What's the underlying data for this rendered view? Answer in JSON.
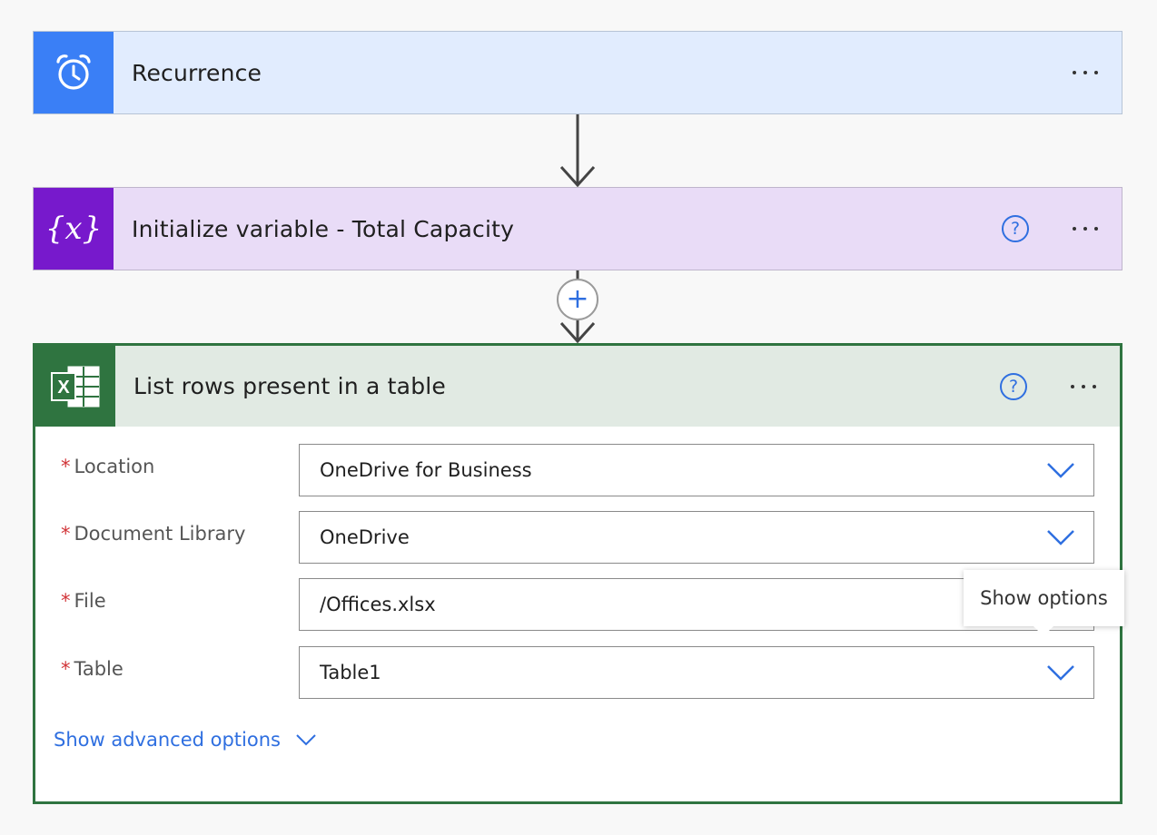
{
  "steps": {
    "recurrence": {
      "title": "Recurrence",
      "icon": "alarm-clock-icon",
      "color": "#3a7ff6",
      "bg": "#e1ecfe"
    },
    "init_var": {
      "title": "Initialize variable - Total Capacity",
      "icon": "variable-braces-icon",
      "icon_text": "{x}",
      "color": "#7719cc",
      "bg": "#e9dcf7"
    },
    "list_rows": {
      "title": "List rows present in a table",
      "icon": "excel-icon",
      "icon_letter": "X",
      "color": "#2f7440",
      "bg": "#e1eae3"
    }
  },
  "help_symbol": "?",
  "add_step_symbol": "+",
  "form": {
    "required_marker": "*",
    "fields": [
      {
        "label": "Location",
        "value": "OneDrive for Business",
        "dropdown": true
      },
      {
        "label": "Document Library",
        "value": "OneDrive",
        "dropdown": true
      },
      {
        "label": "File",
        "value": "/Offices.xlsx",
        "dropdown": false
      },
      {
        "label": "Table",
        "value": "Table1",
        "dropdown": true
      }
    ],
    "advanced_label": "Show advanced options"
  },
  "tooltip": {
    "text": "Show options"
  },
  "colors": {
    "link": "#2f6fe0",
    "required": "#d13438",
    "border_selected": "#2f7440"
  }
}
